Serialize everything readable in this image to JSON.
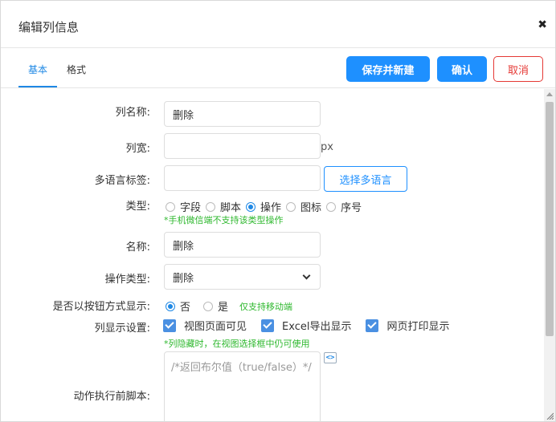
{
  "dialog": {
    "title": "编辑列信息",
    "close_glyph": "✖"
  },
  "tabs": [
    {
      "label": "基本",
      "active": true
    },
    {
      "label": "格式",
      "active": false
    }
  ],
  "actions": {
    "save_new": "保存并新建",
    "confirm": "确认",
    "cancel": "取消"
  },
  "form": {
    "column_name": {
      "label": "列名称:",
      "value": "删除"
    },
    "column_width": {
      "label": "列宽:",
      "value": "",
      "suffix": "px"
    },
    "i18n_label": {
      "label": "多语言标签:",
      "value": "",
      "button": "选择多语言"
    },
    "type": {
      "label": "类型:",
      "options": [
        "字段",
        "脚本",
        "操作",
        "图标",
        "序号"
      ],
      "selected": "操作",
      "hint": "*手机微信端不支持该类型操作"
    },
    "name": {
      "label": "名称:",
      "value": "删除"
    },
    "action_type": {
      "label": "操作类型:",
      "value": "删除"
    },
    "button_display": {
      "label": "是否以按钮方式显示:",
      "options": [
        "否",
        "是"
      ],
      "selected": "否",
      "hint": "仅支持移动端"
    },
    "column_display": {
      "label": "列显示设置:",
      "options": [
        "视图页面可见",
        "Excel导出显示",
        "网页打印显示"
      ],
      "hint": "*列隐藏时，在视图选择框中仍可使用"
    },
    "pre_script": {
      "label": "动作执行前脚本:",
      "placeholder": "/*返回布尔值（true/false）*/"
    }
  },
  "colors": {
    "primary": "#1e90ff",
    "danger": "#e53935",
    "hint": "#2eb82e"
  }
}
